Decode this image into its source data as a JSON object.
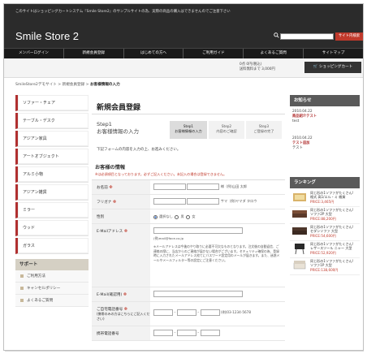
{
  "notice": "このサイトはショッピングカートシステム『Smile Store2』のサンプルサイトの為、実際の商品の購入はできませんのでご注意下さい",
  "store_name": "Smile Store 2",
  "search_button": "サイト内検索",
  "nav": [
    "メンバーログイン",
    "新規会員登録",
    "はじめての方へ",
    "ご利用ガイド",
    "よくあるご質問",
    "サイトマップ"
  ],
  "cart": {
    "line1": "0点 0円(税込)",
    "line2": "送料無料まで 3,000円",
    "button": "ショッピングカート"
  },
  "breadcrumb": {
    "home": "SmileStore2デモサイト",
    "sep": " > ",
    "mid": "新規会員登録",
    "current": "お客様情報の入力"
  },
  "categories": [
    "ソファー・チェア",
    "テーブル・デスク",
    "アジアン家具",
    "アートオブジェクト",
    "アルミ小物",
    "アジアン雑貨",
    "ミラー",
    "ウッド",
    "ガラス"
  ],
  "support": {
    "heading": "サポート",
    "items": [
      "ご利用方法",
      "キャンセルポリシー",
      "よくあるご質問"
    ]
  },
  "main": {
    "title": "新規会員登録",
    "step1_title": "Step1",
    "step1_sub": "お客様情報の入力",
    "steps": [
      {
        "n": "Step1",
        "label": "お客様情報の入力"
      },
      {
        "n": "Step2",
        "label": "内容のご確認"
      },
      {
        "n": "Step3",
        "label": "ご登録の完了"
      }
    ],
    "intro": "下記フォームの内容を入力の上、お進みください。",
    "section": "お客様の情報",
    "note": "※は必須項目となっております。必ずご記入ください。未記入の場合は登録できません。",
    "fields": {
      "name": "お名前",
      "name_hint": "様（例)山田 太郎",
      "kana": "フリガナ",
      "kana_hint": "サマ（例)ヤマダ タロウ",
      "gender": "性別",
      "gender_opts": [
        "選択なし",
        "男",
        "女"
      ],
      "email": "E-Mailアドレス",
      "email_example": "(例)mail@face.co.jp",
      "email_help": "※メールアドレスは今後のやり取りに必要不可欠なものとなります。注文後の自動返信、ご連絡の際に、当店からのご連絡が届かない場合がございます。セキュリティ確保の為、登録時に入力されたメールアドレス宛てにパスワード設定用のメールが届きます。また、迷惑メールやメールフィルター等の設定にご注意ください。",
      "email_confirm": "E-Mail(確認用)",
      "tel": "ご自宅電話番号",
      "tel_sub": "(携帯のみの方はこちらにご記入ください)",
      "tel_example": "(例)03-1234-5678",
      "mobile": "携帯電話番号"
    }
  },
  "news": {
    "heading": "お知らせ",
    "items": [
      {
        "date": "2010.04.22",
        "title": "商品紹介テスト",
        "body": "test"
      },
      {
        "date": "2010.04.22",
        "title": "テスト追加",
        "body": "テスト"
      }
    ]
  },
  "ranking": {
    "heading": "ランキング",
    "items": [
      {
        "tag": "同じ形の1ソファがたくさん!",
        "name": "格式 高1/エル・ミ 雑貨",
        "price": "PRICE:3,465円"
      },
      {
        "tag": "同じ形の1ソファがたくさん!",
        "name": "ソファ2P 大型",
        "price": "PRICE:88,200円"
      },
      {
        "tag": "同じ形の1ソファがたくさん!",
        "name": "セダンソファ 大型",
        "price": "PRICE:54,600円"
      },
      {
        "tag": "同じ形の1ソファがたくさん!",
        "name": "レザースツール ニャー 大型",
        "price": "PRICE:52,920円"
      },
      {
        "tag": "同じ形の1ソファがたくさん!",
        "name": "ソファ1P 大型",
        "price": "PRICE:138,600円"
      }
    ]
  }
}
